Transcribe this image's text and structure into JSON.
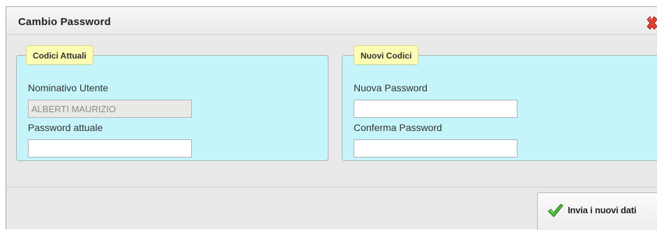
{
  "dialog": {
    "title": "Cambio Password",
    "close_icon": "close-x-icon"
  },
  "current_codes": {
    "legend": "Codici Attuali",
    "user_label": "Nominativo Utente",
    "user_value": "ALBERTI MAURIZIO",
    "current_password_label": "Password attuale",
    "current_password_value": ""
  },
  "new_codes": {
    "legend": "Nuovi Codici",
    "new_password_label": "Nuova Password",
    "new_password_value": "",
    "confirm_password_label": "Conferma Password",
    "confirm_password_value": ""
  },
  "footer": {
    "submit_label": "Invia i nuovi dati",
    "submit_icon": "checkmark-icon"
  },
  "colors": {
    "panel_bg": "#c6f4fb",
    "legend_bg": "#fdfcb4",
    "close_red": "#d9362b",
    "check_green": "#3fa32a"
  }
}
